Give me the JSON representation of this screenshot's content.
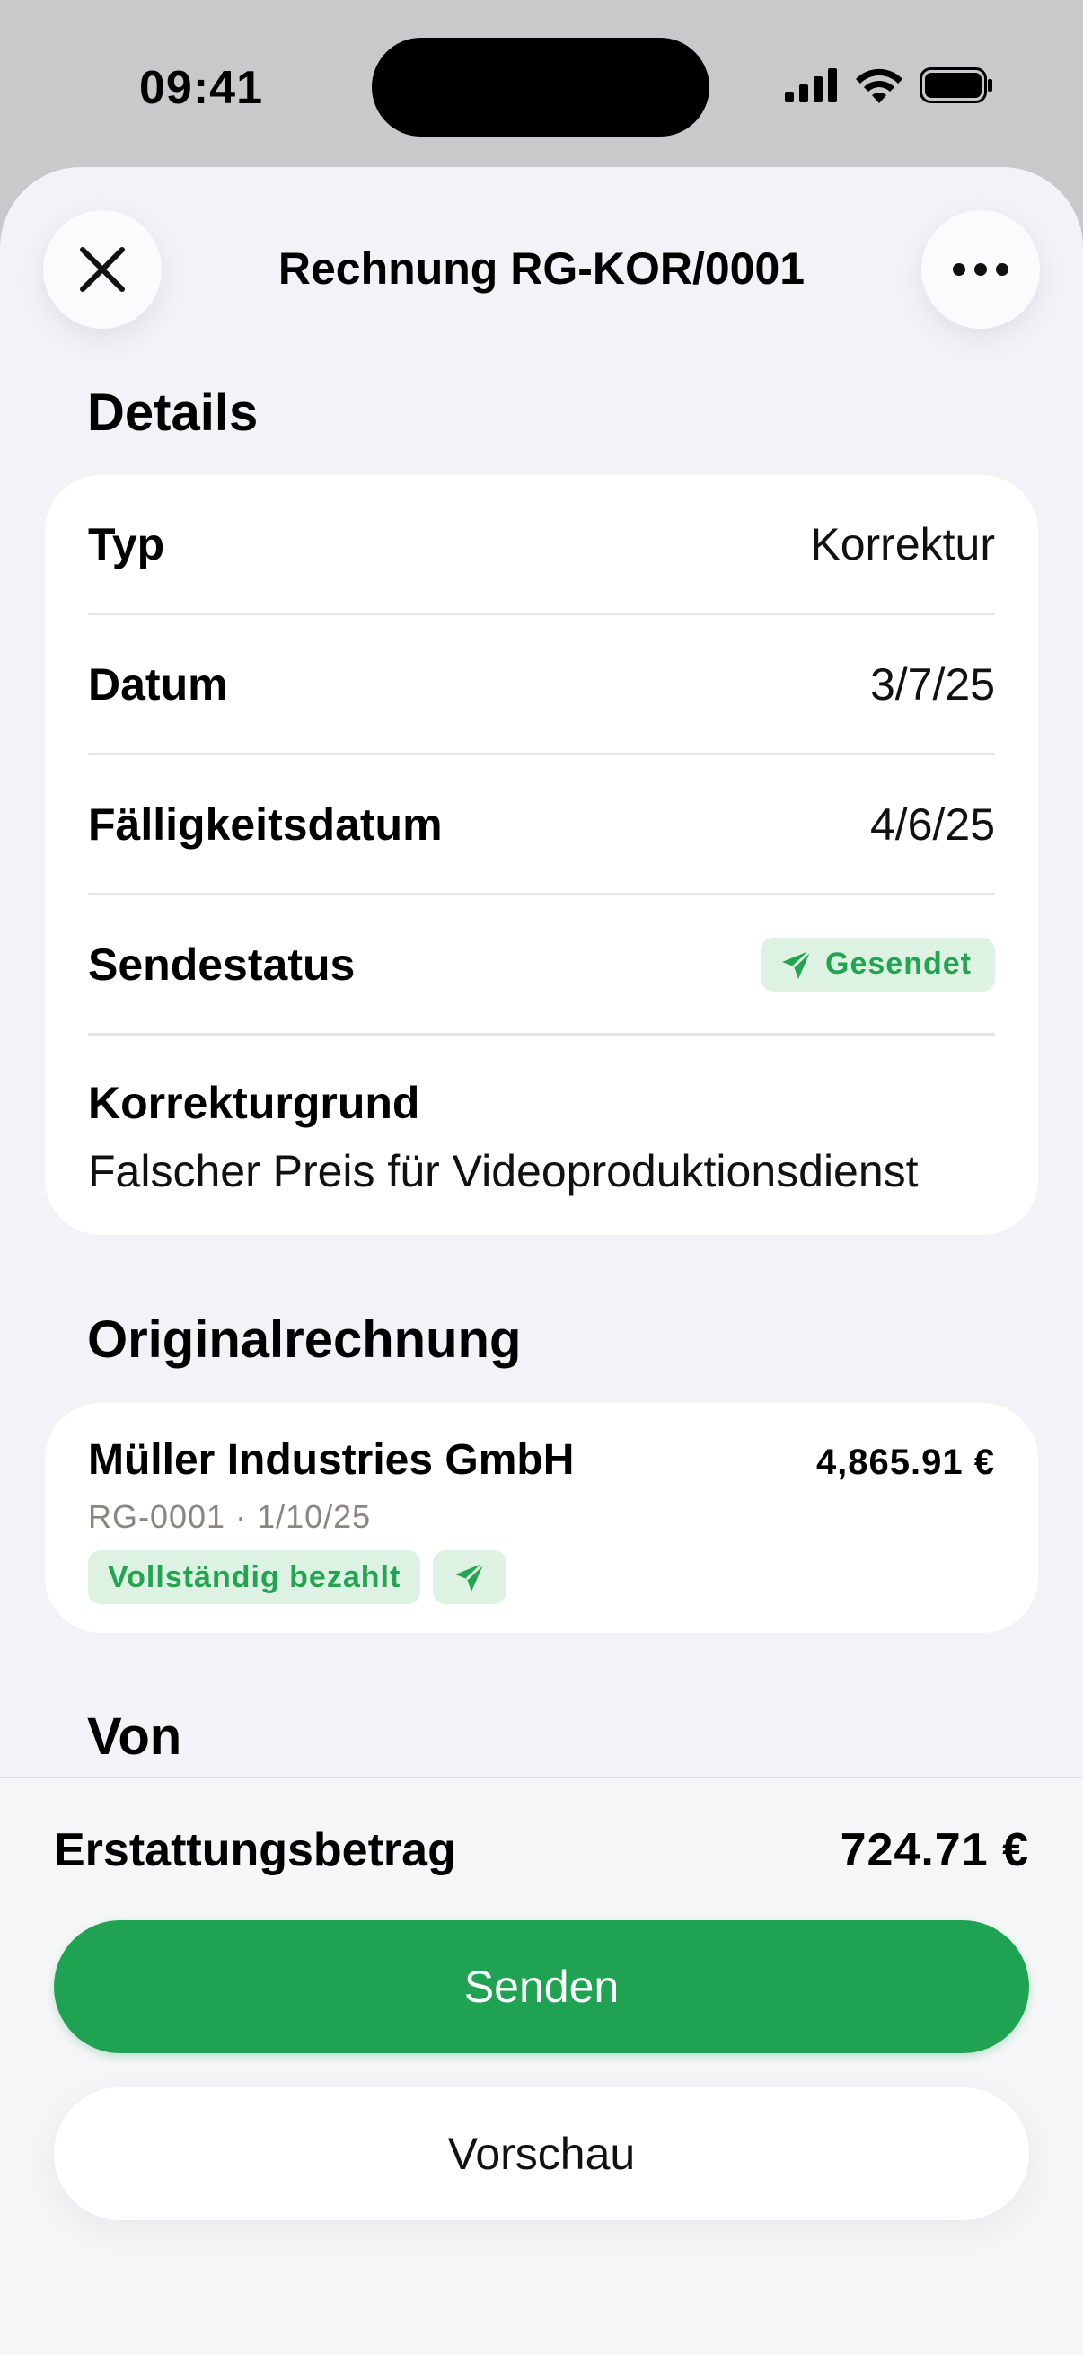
{
  "status_bar": {
    "time": "09:41"
  },
  "header": {
    "title": "Rechnung RG-KOR/0001"
  },
  "details": {
    "section_title": "Details",
    "rows": [
      {
        "label": "Typ",
        "value": "Korrektur"
      },
      {
        "label": "Datum",
        "value": "3/7/25"
      },
      {
        "label": "Fälligkeitsdatum",
        "value": "4/6/25"
      },
      {
        "label": "Sendestatus",
        "value": "Gesendet"
      }
    ],
    "reason_label": "Korrekturgrund",
    "reason_text": "Falscher Preis für Videoproduktionsdienst"
  },
  "original": {
    "section_title": "Originalrechnung",
    "customer": "Müller Industries GmbH",
    "amount": "4,865.91 €",
    "meta": "RG-0001 · 1/10/25",
    "paid_badge": "Vollständig bezahlt"
  },
  "from": {
    "section_title": "Von"
  },
  "footer": {
    "refund_label": "Erstattungsbetrag",
    "refund_amount": "724.71 €",
    "send_label": "Senden",
    "preview_label": "Vorschau"
  },
  "colors": {
    "accent_green": "#1fa352",
    "badge_bg": "#ddf2e3",
    "badge_text": "#22a451"
  }
}
